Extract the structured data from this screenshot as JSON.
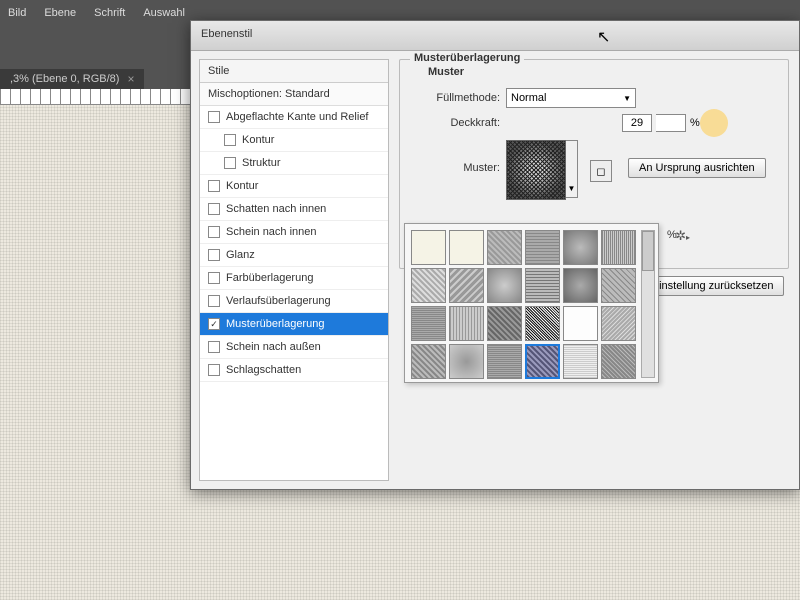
{
  "menu": [
    "Bild",
    "Ebene",
    "Schrift",
    "Auswahl"
  ],
  "doc_tab": ",3% (Ebene 0, RGB/8)",
  "dialog": {
    "title": "Ebenenstil",
    "styles_header": "Stile",
    "blend_options": "Mischoptionen: Standard",
    "effects": [
      {
        "label": "Abgeflachte Kante und Relief",
        "checked": false,
        "sub": false
      },
      {
        "label": "Kontur",
        "checked": false,
        "sub": true
      },
      {
        "label": "Struktur",
        "checked": false,
        "sub": true
      },
      {
        "label": "Kontur",
        "checked": false,
        "sub": false
      },
      {
        "label": "Schatten nach innen",
        "checked": false,
        "sub": false
      },
      {
        "label": "Schein nach innen",
        "checked": false,
        "sub": false
      },
      {
        "label": "Glanz",
        "checked": false,
        "sub": false
      },
      {
        "label": "Farbüberlagerung",
        "checked": false,
        "sub": false
      },
      {
        "label": "Verlaufsüberlagerung",
        "checked": false,
        "sub": false
      },
      {
        "label": "Musterüberlagerung",
        "checked": true,
        "sub": false,
        "selected": true
      },
      {
        "label": "Schein nach außen",
        "checked": false,
        "sub": false
      },
      {
        "label": "Schlagschatten",
        "checked": false,
        "sub": false
      }
    ],
    "panel": {
      "title": "Musterüberlagerung",
      "subtitle": "Muster",
      "blend_label": "Füllmethode:",
      "blend_value": "Normal",
      "opacity_label": "Deckkraft:",
      "opacity_value": "29",
      "pattern_label": "Muster:",
      "snap_btn": "An Ursprung ausrichten",
      "percent": "%",
      "reset_btn": "einstellung zurücksetzen"
    }
  }
}
